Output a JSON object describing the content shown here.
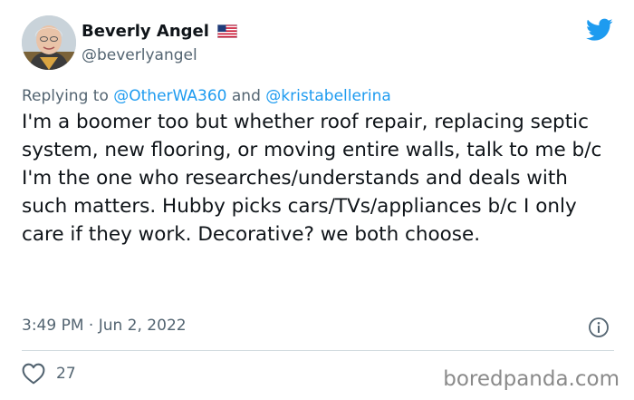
{
  "author": {
    "display_name": "Beverly Angel",
    "handle": "@beverlyangel",
    "flag_icon": "us-flag-icon",
    "avatar_icon": "profile-photo"
  },
  "reply": {
    "prefix": "Replying to",
    "mention_1": "@OtherWA360",
    "conjunction": "and",
    "mention_2": "@kristabellerina"
  },
  "tweet": {
    "text": "I'm a boomer too but whether roof repair, replacing septic system, new flooring, or moving entire walls, talk to me b/c I'm the one who researches/understands and deals with such matters. Hubby picks cars/TVs/appliances b/c I only care if they work. Decorative? we both choose.",
    "time": "3:49 PM",
    "separator": "·",
    "date": "Jun 2, 2022"
  },
  "actions": {
    "like_count": "27",
    "like_icon": "heart-outline-icon",
    "info_icon": "info-circle-icon"
  },
  "brand": {
    "twitter_icon": "twitter-bird-icon",
    "twitter_color": "#1d9bf0",
    "watermark": "boredpanda.com"
  },
  "colors": {
    "text": "#0f1419",
    "secondary": "#536471",
    "accent": "#1d9bf0",
    "divider": "#cfd9de"
  }
}
